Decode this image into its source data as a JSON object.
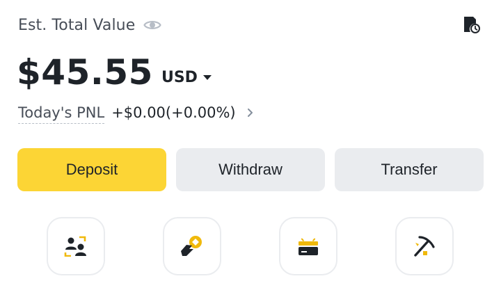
{
  "header": {
    "est_label": "Est. Total Value",
    "eye_icon": "eye-icon",
    "history_icon": "history-icon"
  },
  "balance": {
    "amount": "$45.55",
    "currency": "USD"
  },
  "pnl": {
    "label": "Today's PNL",
    "value": "+$0.00(+0.00%)"
  },
  "actions": {
    "deposit": "Deposit",
    "withdraw": "Withdraw",
    "transfer": "Transfer"
  },
  "shortcuts": [
    {
      "icon": "users-icon"
    },
    {
      "icon": "coin-hand-icon"
    },
    {
      "icon": "gift-card-icon"
    },
    {
      "icon": "pickaxe-icon"
    }
  ],
  "colors": {
    "accent": "#fcd535",
    "text": "#1e2329",
    "secondary_text": "#474d57",
    "button_gray": "#eaecef"
  }
}
